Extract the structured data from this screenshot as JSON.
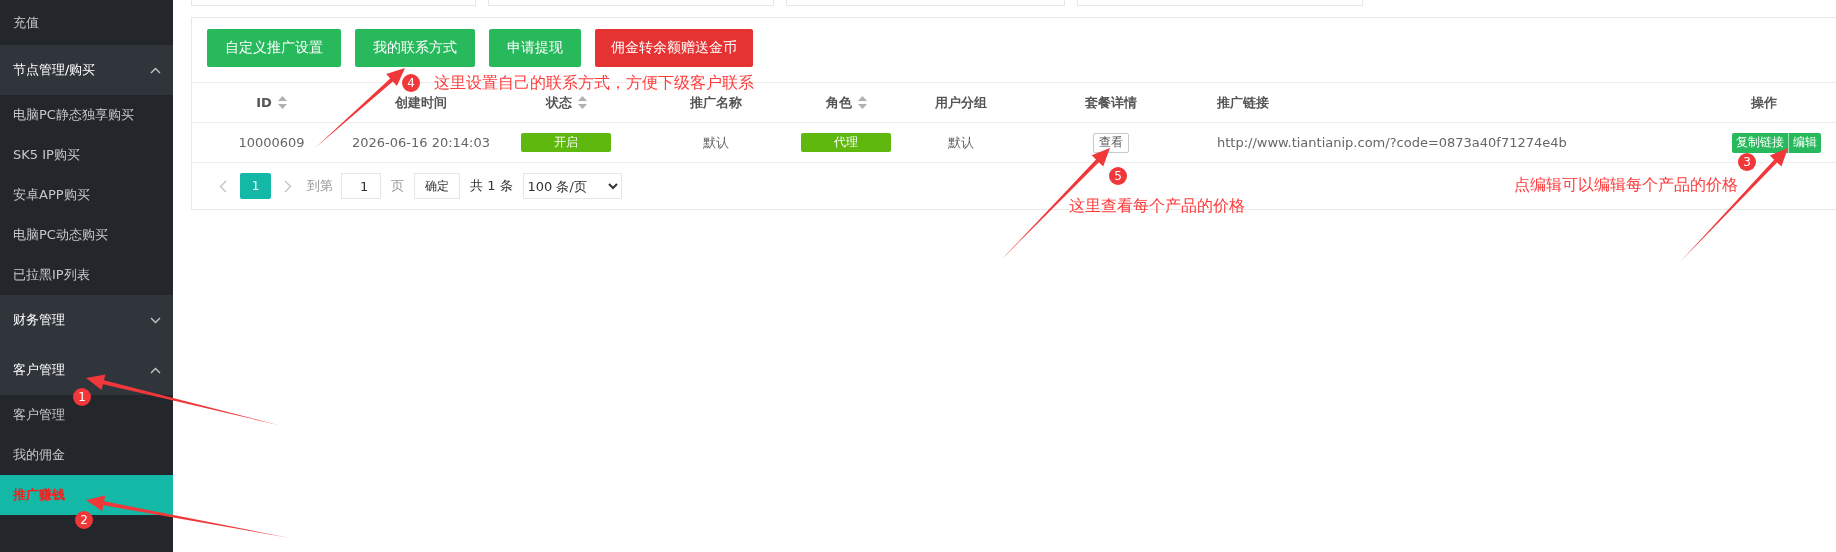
{
  "sidebar": {
    "items": [
      {
        "kind": "item",
        "label": "充值",
        "selected": false
      },
      {
        "kind": "group",
        "label": "节点管理/购买",
        "expanded": true,
        "children": [
          {
            "label": "电脑PC静态独享购买",
            "selected": false
          },
          {
            "label": "SK5 IP购买",
            "selected": false
          },
          {
            "label": "安卓APP购买",
            "selected": false
          },
          {
            "label": "电脑PC动态购买",
            "selected": false
          },
          {
            "label": "已拉黑IP列表",
            "selected": false
          }
        ]
      },
      {
        "kind": "group",
        "label": "财务管理",
        "expanded": false
      },
      {
        "kind": "group",
        "label": "客户管理",
        "expanded": true,
        "children": [
          {
            "label": "客户管理",
            "selected": false
          },
          {
            "label": "我的佣金",
            "selected": false
          },
          {
            "label": "推广赚钱",
            "selected": true
          }
        ]
      }
    ]
  },
  "toolbar": {
    "buttons": [
      {
        "label": "自定义推广设置",
        "kind": "primary"
      },
      {
        "label": "我的联系方式",
        "kind": "primary"
      },
      {
        "label": "申请提现",
        "kind": "primary"
      },
      {
        "label": "佣金转余额赠送金币",
        "kind": "danger"
      }
    ]
  },
  "table": {
    "columns": [
      {
        "label": "ID",
        "kind": "sortable"
      },
      {
        "label": "创建时间",
        "kind": "plain"
      },
      {
        "label": "状态",
        "kind": "sortable"
      },
      {
        "label": "推广名称",
        "kind": "plain"
      },
      {
        "label": "角色",
        "kind": "sortable"
      },
      {
        "label": "用户分组",
        "kind": "plain"
      },
      {
        "label": "套餐详情",
        "kind": "plain"
      },
      {
        "label": "推广链接",
        "kind": "plain"
      },
      {
        "label": "操作",
        "kind": "plain"
      }
    ],
    "rows": [
      {
        "id": "10000609",
        "created": "2026-06-16 20:14:03",
        "status": "开启",
        "name": "默认",
        "role": "代理",
        "group": "默认",
        "details": "查看",
        "link": "http://www.tiantianip.com/?code=0873a40f71274e4b",
        "actions": [
          "复制链接",
          "编辑"
        ]
      }
    ]
  },
  "pagination": {
    "pages": [
      {
        "label": "1",
        "selected": true
      }
    ],
    "goto_label": "到第",
    "page_input": "1",
    "page_suffix": "页",
    "confirm": "确定",
    "total": "共 1 条",
    "page_size": "100 条/页"
  },
  "annotations": [
    {
      "number": "1"
    },
    {
      "number": "2"
    },
    {
      "number": "3",
      "text": "点编辑可以编辑每个产品的价格"
    },
    {
      "number": "4",
      "text": "这里设置自己的联系方式，方便下级客户联系"
    },
    {
      "number": "5",
      "text": "这里查看每个产品的价格"
    }
  ]
}
